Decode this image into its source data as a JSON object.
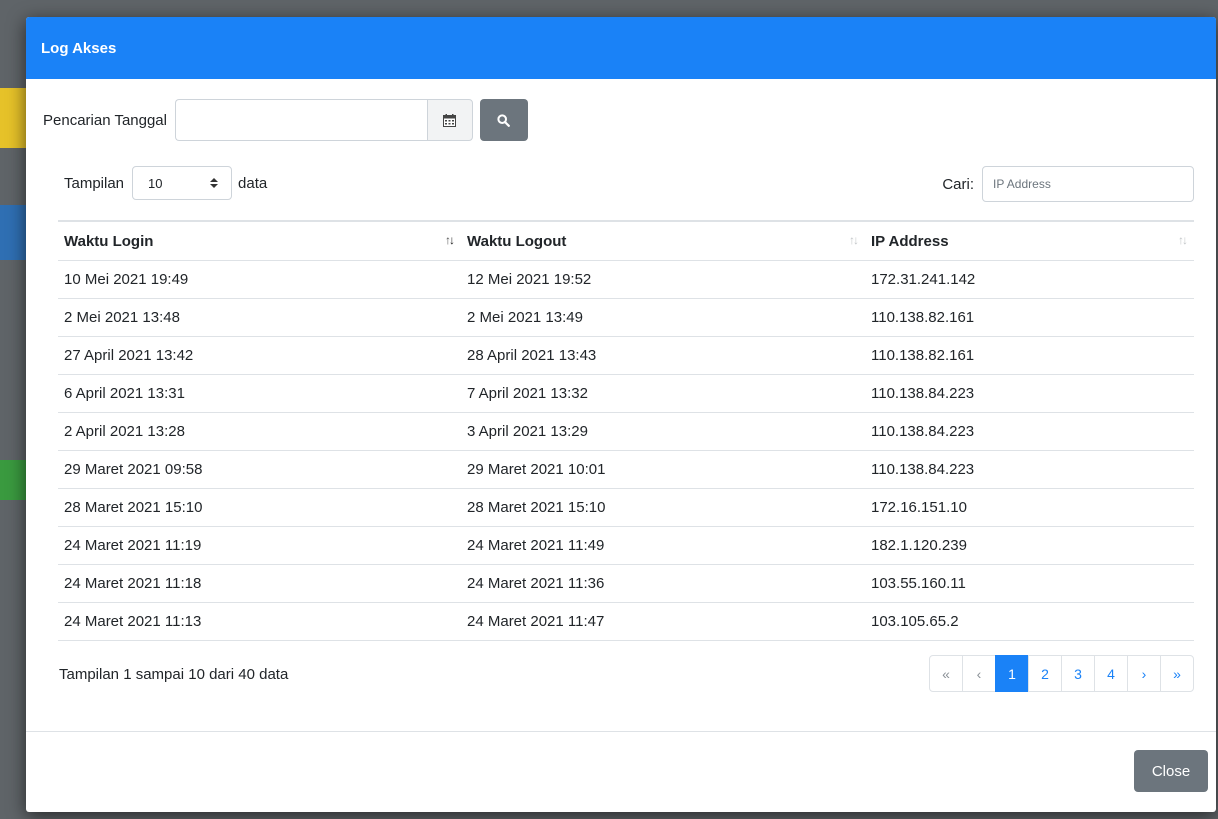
{
  "modal": {
    "title": "Log Akses",
    "close_label": "Close"
  },
  "search": {
    "label": "Pencarian Tanggal",
    "date_value": ""
  },
  "length": {
    "prefix": "Tampilan",
    "value": "10",
    "suffix": "data"
  },
  "filter": {
    "label": "Cari:",
    "placeholder": "IP Address"
  },
  "table": {
    "headers": [
      "Waktu Login",
      "Waktu Logout",
      "IP Address"
    ],
    "rows": [
      [
        "10 Mei 2021 19:49",
        "12 Mei 2021 19:52",
        "172.31.241.142"
      ],
      [
        "2 Mei 2021 13:48",
        "2 Mei 2021 13:49",
        "110.138.82.161"
      ],
      [
        "27 April 2021 13:42",
        "28 April 2021 13:43",
        "110.138.82.161"
      ],
      [
        "6 April 2021 13:31",
        "7 April 2021 13:32",
        "110.138.84.223"
      ],
      [
        "2 April 2021 13:28",
        "3 April 2021 13:29",
        "110.138.84.223"
      ],
      [
        "29 Maret 2021 09:58",
        "29 Maret 2021 10:01",
        "110.138.84.223"
      ],
      [
        "28 Maret 2021 15:10",
        "28 Maret 2021 15:10",
        "172.16.151.10"
      ],
      [
        "24 Maret 2021 11:19",
        "24 Maret 2021 11:49",
        "182.1.120.239"
      ],
      [
        "24 Maret 2021 11:18",
        "24 Maret 2021 11:36",
        "103.55.160.11"
      ],
      [
        "24 Maret 2021 11:13",
        "24 Maret 2021 11:47",
        "103.105.65.2"
      ]
    ]
  },
  "info": "Tampilan 1 sampai 10 dari 40 data",
  "pagination": {
    "first": "«",
    "prev": "‹",
    "pages": [
      "1",
      "2",
      "3",
      "4"
    ],
    "next": "›",
    "last": "»",
    "active_page": "1"
  },
  "colors": {
    "header_bg": "#1a82f7",
    "button_gray": "#6c757d",
    "link_blue": "#1a82f7"
  }
}
